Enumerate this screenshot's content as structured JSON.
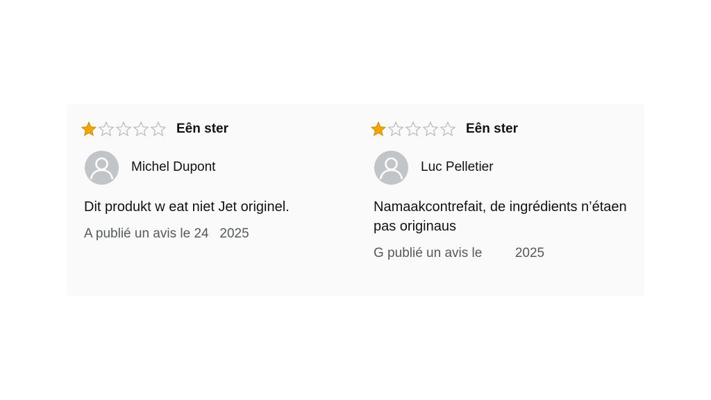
{
  "reviews": [
    {
      "rating": 1,
      "max_rating": 5,
      "rating_label": "Eên ster",
      "author": "Michel Dupont",
      "text": "Dit produkt w eat niet Jet originel.",
      "date": "A publié un avis le 24   2025",
      "star_filled_color": "#f0a800",
      "avatar_icon": "user-silhouette-icon"
    },
    {
      "rating": 1,
      "max_rating": 5,
      "rating_label": "Eên ster",
      "author": "Luc Pelletier",
      "text": "Namaakcontrefait, de ingrédients n’étaen pas originaus",
      "date": "G publié un avis le         2025",
      "star_filled_color": "#f0a800",
      "avatar_icon": "user-silhouette-icon"
    }
  ]
}
